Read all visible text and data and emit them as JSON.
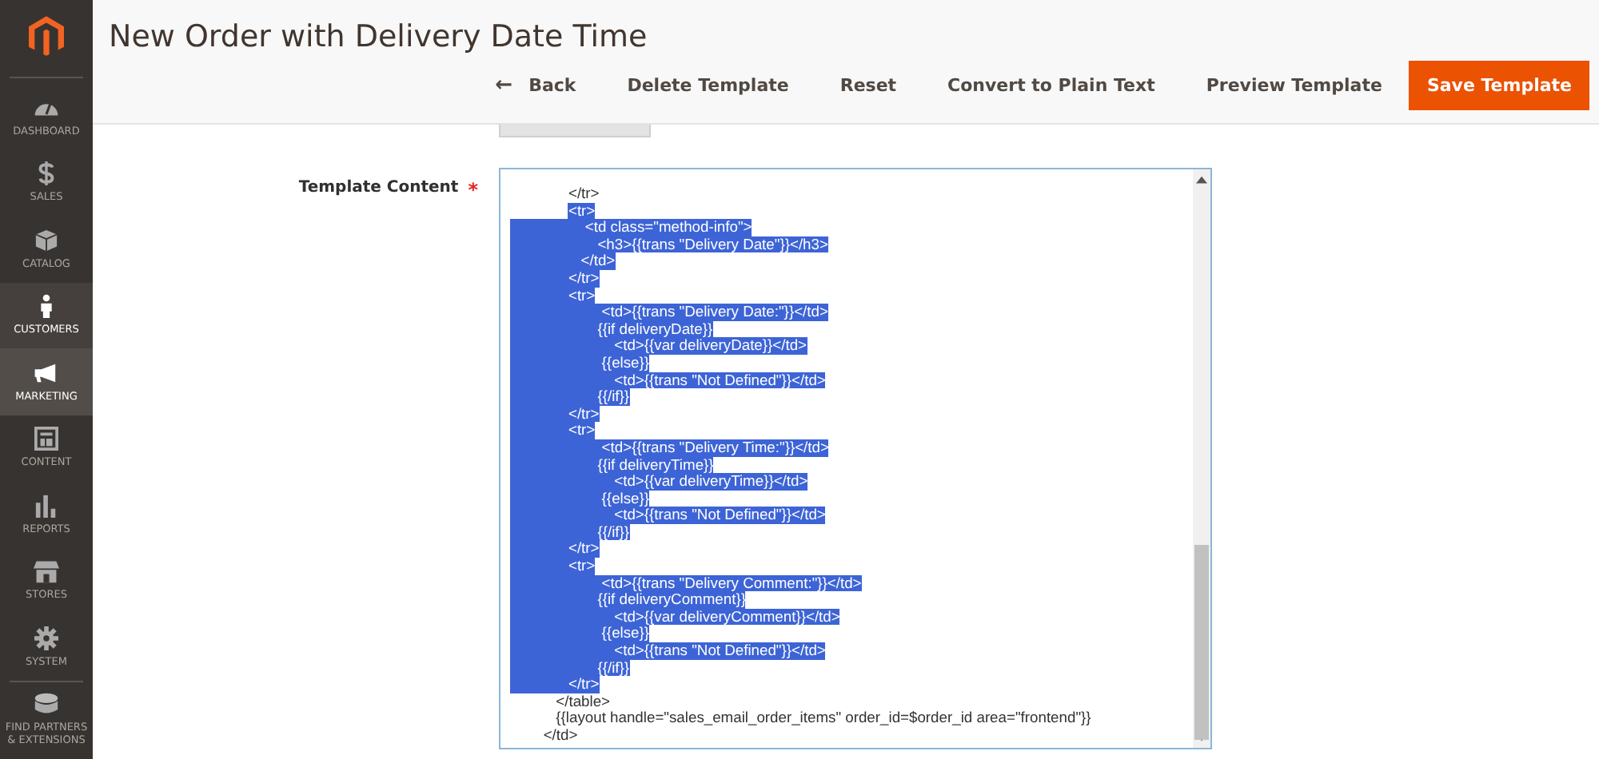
{
  "sidebar": {
    "items": [
      {
        "label": "DASHBOARD",
        "selected": false,
        "hovered": false
      },
      {
        "label": "SALES",
        "selected": false,
        "hovered": false
      },
      {
        "label": "CATALOG",
        "selected": false,
        "hovered": false
      },
      {
        "label": "CUSTOMERS",
        "selected": false,
        "hovered": true
      },
      {
        "label": "MARKETING",
        "selected": true,
        "hovered": false
      },
      {
        "label": "CONTENT",
        "selected": false,
        "hovered": false
      },
      {
        "label": "REPORTS",
        "selected": false,
        "hovered": false
      },
      {
        "label": "STORES",
        "selected": false,
        "hovered": false
      },
      {
        "label": "SYSTEM",
        "selected": false,
        "hovered": false
      },
      {
        "label": "FIND PARTNERS & EXTENSIONS",
        "selected": false,
        "hovered": false
      }
    ]
  },
  "page": {
    "title": "New Order with Delivery Date Time"
  },
  "toolbar": {
    "back": {
      "label": "Back",
      "icon": "←"
    },
    "buttons": [
      {
        "label": "Delete Template",
        "kind": "plain"
      },
      {
        "label": "Reset",
        "kind": "plain"
      },
      {
        "label": "Convert to Plain Text",
        "kind": "plain"
      },
      {
        "label": "Preview Template",
        "kind": "plain"
      },
      {
        "label": "Save Template",
        "kind": "primary"
      }
    ]
  },
  "field": {
    "label": "Template Content",
    "required_mark": "*",
    "required": true,
    "lines": [
      {
        "text": "              </tr>",
        "selected": false
      },
      {
        "text": "              <tr>",
        "selected": true
      },
      {
        "text": "                  <td class=\"method-info\">",
        "selected": true
      },
      {
        "text": "                     <h3>{{trans \"Delivery Date\"}}</h3>",
        "selected": true
      },
      {
        "text": "                 </td>",
        "selected": true
      },
      {
        "text": "              </tr>",
        "selected": true
      },
      {
        "text": "              <tr>",
        "selected": true
      },
      {
        "text": "                      <td>{{trans \"Delivery Date:\"}}</td>",
        "selected": true
      },
      {
        "text": "                     {{if deliveryDate}}",
        "selected": true
      },
      {
        "text": "                         <td>{{var deliveryDate}}</td>",
        "selected": true
      },
      {
        "text": "                      {{else}}",
        "selected": true
      },
      {
        "text": "                         <td>{{trans \"Not Defined\"}}</td>",
        "selected": true
      },
      {
        "text": "                     {{/if}}",
        "selected": true
      },
      {
        "text": "              </tr>",
        "selected": true
      },
      {
        "text": "              <tr>",
        "selected": true
      },
      {
        "text": "                      <td>{{trans \"Delivery Time:\"}}</td>",
        "selected": true
      },
      {
        "text": "                     {{if deliveryTime}}",
        "selected": true
      },
      {
        "text": "                         <td>{{var deliveryTime}}</td>",
        "selected": true
      },
      {
        "text": "                      {{else}}",
        "selected": true
      },
      {
        "text": "                         <td>{{trans \"Not Defined\"}}</td>",
        "selected": true
      },
      {
        "text": "                     {{/if}}",
        "selected": true
      },
      {
        "text": "              </tr>",
        "selected": true
      },
      {
        "text": "              <tr>",
        "selected": true
      },
      {
        "text": "                      <td>{{trans \"Delivery Comment:\"}}</td>",
        "selected": true
      },
      {
        "text": "                     {{if deliveryComment}}",
        "selected": true
      },
      {
        "text": "                         <td>{{var deliveryComment}}</td>",
        "selected": true
      },
      {
        "text": "                      {{else}}",
        "selected": true
      },
      {
        "text": "                         <td>{{trans \"Not Defined\"}}</td>",
        "selected": true
      },
      {
        "text": "                     {{/if}}",
        "selected": true
      },
      {
        "text": "              </tr>",
        "selected": true
      },
      {
        "text": "           </table>",
        "selected": false
      },
      {
        "text": "           {{layout handle=\"sales_email_order_items\" order_id=$order_id area=\"frontend\"}}",
        "selected": false
      },
      {
        "text": "        </td>",
        "selected": false
      }
    ]
  }
}
